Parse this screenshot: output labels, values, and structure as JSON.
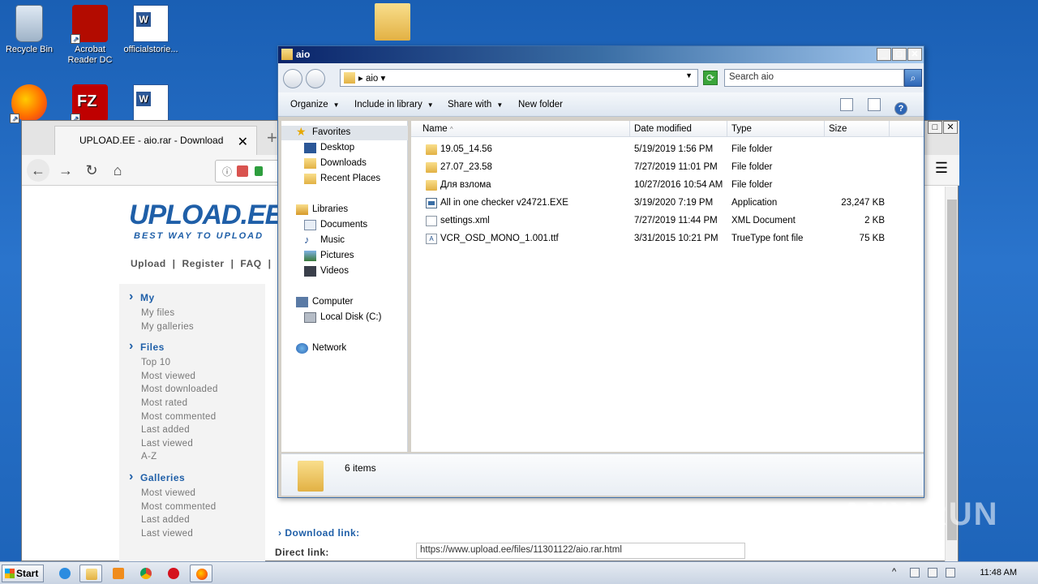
{
  "desktop": {
    "icons": [
      {
        "label": "Recycle Bin"
      },
      {
        "label": "Acrobat Reader DC"
      },
      {
        "label": "officialstorie..."
      }
    ]
  },
  "browser": {
    "tab_title": "UPLOAD.EE - aio.rar - Download",
    "tab_close": "✕",
    "new_tab": "+",
    "site": {
      "logo": "UPLOAD.EE",
      "tagline": "BEST WAY TO UPLOAD",
      "topnav": [
        "Upload",
        "|",
        "Register",
        "|",
        "FAQ",
        "|"
      ],
      "menu": {
        "my": {
          "heading": "My",
          "items": [
            "My files",
            "My galleries"
          ]
        },
        "files": {
          "heading": "Files",
          "items": [
            "Top 10",
            "Most viewed",
            "Most downloaded",
            "Most rated",
            "Most commented",
            "Last added",
            "Last viewed",
            "A-Z"
          ]
        },
        "galleries": {
          "heading": "Galleries",
          "items": [
            "Most viewed",
            "Most commented",
            "Last added",
            "Last viewed"
          ]
        }
      },
      "download_heading": "Download link:",
      "direct_label": "Direct link:",
      "direct_url": "https://www.upload.ee/files/11301122/aio.rar.html"
    }
  },
  "explorer": {
    "title": "aio",
    "address": "aio",
    "search_placeholder": "Search aio",
    "toolbar": {
      "organize": "Organize",
      "include": "Include in library",
      "share": "Share with",
      "new_folder": "New folder"
    },
    "nav": {
      "favorites": "Favorites",
      "desktop": "Desktop",
      "downloads": "Downloads",
      "recent": "Recent Places",
      "libraries": "Libraries",
      "documents": "Documents",
      "music": "Music",
      "pictures": "Pictures",
      "videos": "Videos",
      "computer": "Computer",
      "local_disk": "Local Disk (C:)",
      "network": "Network"
    },
    "columns": {
      "name": "Name",
      "date": "Date modified",
      "type": "Type",
      "size": "Size"
    },
    "files": [
      {
        "name": "19.05_14.56",
        "date": "5/19/2019 1:56 PM",
        "type": "File folder",
        "size": "",
        "icon": "folder"
      },
      {
        "name": "27.07_23.58",
        "date": "7/27/2019 11:01 PM",
        "type": "File folder",
        "size": "",
        "icon": "folder"
      },
      {
        "name": "Для взлома",
        "date": "10/27/2016 10:54 AM",
        "type": "File folder",
        "size": "",
        "icon": "folder"
      },
      {
        "name": "All in one checker v24721.EXE",
        "date": "3/19/2020 7:19 PM",
        "type": "Application",
        "size": "23,247 KB",
        "icon": "app"
      },
      {
        "name": "settings.xml",
        "date": "7/27/2019 11:44 PM",
        "type": "XML Document",
        "size": "2 KB",
        "icon": "xml"
      },
      {
        "name": "VCR_OSD_MONO_1.001.ttf",
        "date": "3/31/2015 10:21 PM",
        "type": "TrueType font file",
        "size": "75 KB",
        "icon": "ttf"
      }
    ],
    "item_count": "6 items"
  },
  "taskbar": {
    "start_label": "Start",
    "clock": "11:48 AM"
  },
  "watermark": "ANY RUN"
}
